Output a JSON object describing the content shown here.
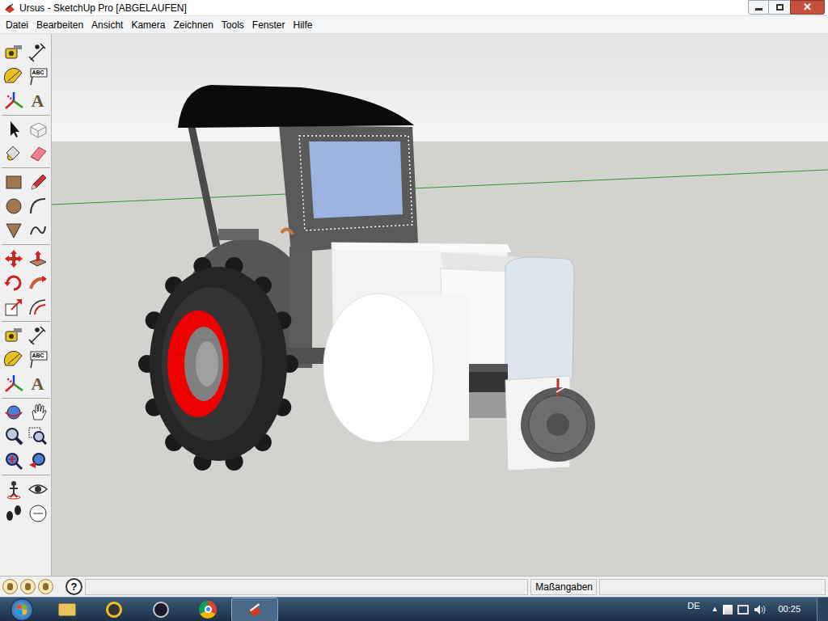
{
  "window": {
    "title": "Ursus - SketchUp Pro [ABGELAUFEN]"
  },
  "menu": [
    "Datei",
    "Bearbeiten",
    "Ansicht",
    "Kamera",
    "Zeichnen",
    "Tools",
    "Fenster",
    "Hilfe"
  ],
  "toolbar": {
    "text_tool_label": "ABC",
    "text_3d_label": "A"
  },
  "status_bar": {
    "help": "?",
    "measurements_label": "Maßangaben",
    "measurements_value": ""
  },
  "taskbar": {
    "language": "DE",
    "time": "00:25"
  }
}
